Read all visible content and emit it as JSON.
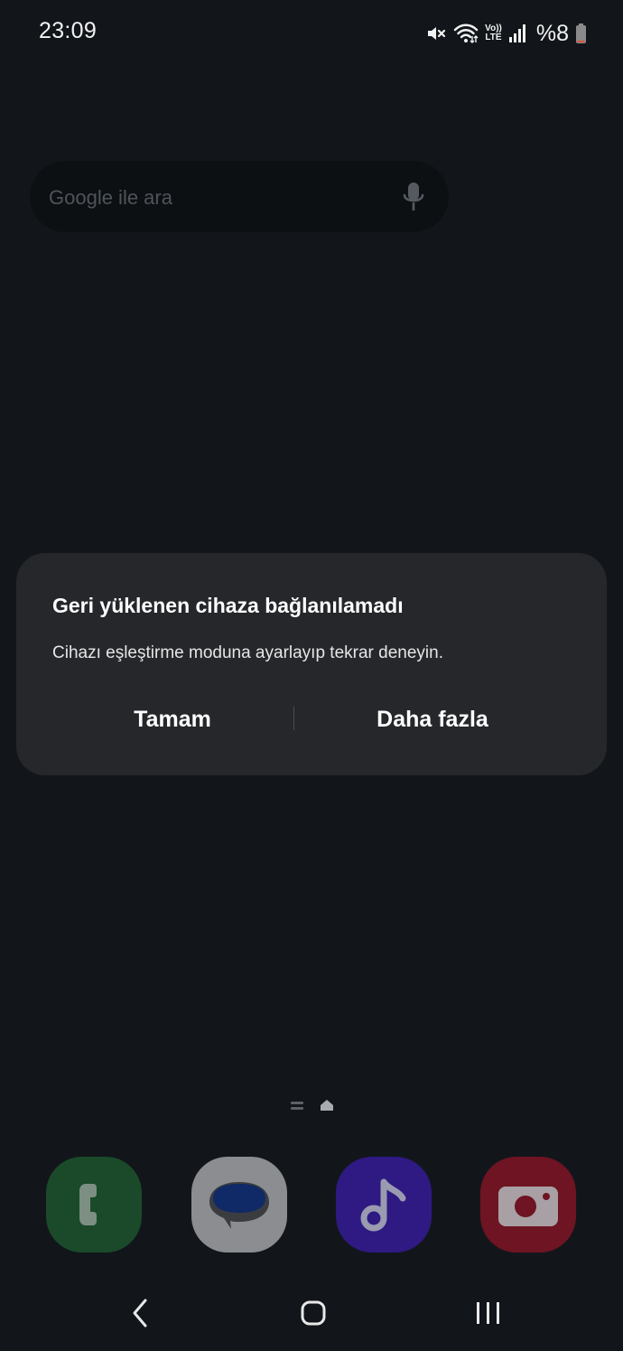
{
  "status_bar": {
    "time": "23:09",
    "volte_top": "Vo))",
    "volte_bottom": "LTE",
    "battery": "%8",
    "icons": [
      "mute-icon",
      "wifi-icon",
      "volte-icon",
      "signal-icon",
      "battery-icon"
    ]
  },
  "search": {
    "placeholder": "Google ile ara",
    "mic_icon": "mic-icon"
  },
  "dialog": {
    "title": "Geri yüklenen cihaza bağlanılamadı",
    "message": "Cihazı eşleştirme moduna ayarlayıp tekrar deneyin.",
    "ok_label": "Tamam",
    "more_label": "Daha fazla"
  },
  "dock": {
    "apps": [
      {
        "icon": "phone-icon",
        "color": "#1a4a2a"
      },
      {
        "icon": "messages-icon",
        "color": "#8b8d90"
      },
      {
        "icon": "music-icon",
        "color": "#2e1a82"
      },
      {
        "icon": "camera-icon",
        "color": "#6e1422"
      }
    ]
  },
  "nav_bar": {
    "icons": [
      "back-icon",
      "home-icon",
      "recents-icon"
    ]
  },
  "colors": {
    "background": "#12161b",
    "dialog_background": "#25272b",
    "search_background": "#0d1013"
  }
}
